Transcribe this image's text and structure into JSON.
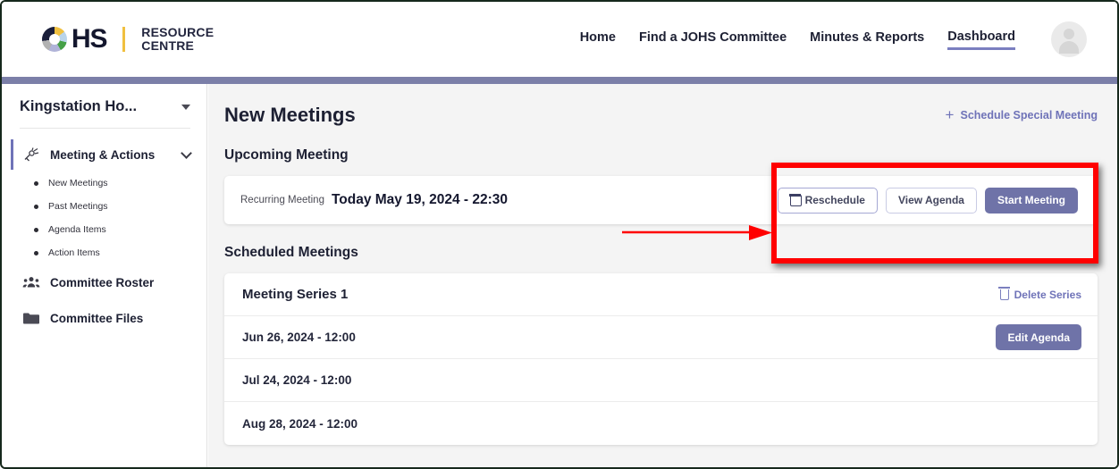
{
  "header": {
    "logo": {
      "mark": "ohs-circle-icon",
      "hs": "HS",
      "line1": "RESOURCE",
      "line2": "CENTRE"
    },
    "nav": [
      {
        "label": "Home",
        "active": false
      },
      {
        "label": "Find a JOHS Committee",
        "active": false
      },
      {
        "label": "Minutes & Reports",
        "active": false
      },
      {
        "label": "Dashboard",
        "active": true
      }
    ],
    "avatar_label": "user-avatar",
    "accent_bar_color": "#7b7fa8"
  },
  "sidebar": {
    "org": "Kingstation Ho...",
    "group": {
      "label": "Meeting & Actions",
      "icon": "meeting-actions-icon",
      "expanded": true
    },
    "subitems": [
      {
        "label": "New Meetings"
      },
      {
        "label": "Past Meetings"
      },
      {
        "label": "Agenda Items"
      },
      {
        "label": "Action Items"
      }
    ],
    "links": [
      {
        "label": "Committee Roster",
        "icon": "people-group-icon"
      },
      {
        "label": "Committee Files",
        "icon": "folder-icon"
      }
    ]
  },
  "main": {
    "page_title": "New Meetings",
    "schedule_special": "Schedule Special Meeting",
    "upcoming_label": "Upcoming Meeting",
    "upcoming": {
      "kind": "Recurring Meeting",
      "when": "Today May 19, 2024 - 22:30",
      "buttons": {
        "reschedule": "Reschedule",
        "view_agenda": "View Agenda",
        "start_meeting": "Start Meeting"
      }
    },
    "scheduled_label": "Scheduled Meetings",
    "series": {
      "title": "Meeting Series 1",
      "delete_label": "Delete Series",
      "edit_agenda_label": "Edit Agenda",
      "dates": [
        "Jun 26, 2024 - 12:00",
        "Jul 24, 2024 - 12:00",
        "Aug 28, 2024 - 12:00"
      ]
    }
  },
  "annotations": {
    "highlight_color": "#ff0000",
    "arrow_color": "#ff0000"
  }
}
